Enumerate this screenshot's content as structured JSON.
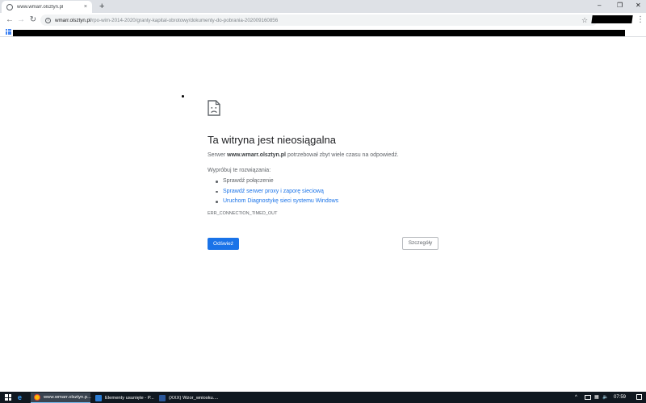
{
  "browser": {
    "tab": {
      "title": "www.wmarr.olsztyn.pl",
      "close_icon": "×"
    },
    "new_tab_icon": "+",
    "window_controls": {
      "minimize": "–",
      "maximize": "❐",
      "close": "✕"
    },
    "nav": {
      "back": "←",
      "forward": "→",
      "reload": "↻"
    },
    "address": {
      "host": "wmarr.olsztyn.pl",
      "path": "/rpo-wim-2014-2020/granty-kapital-obrotowy/dokumenty-do-pobrania-202009160856"
    },
    "star_icon": "☆",
    "menu_icon": "⋮"
  },
  "error_page": {
    "title": "Ta witryna jest nieosiągalna",
    "desc_prefix": "Serwer ",
    "desc_host": "www.wmarr.olsztyn.pl",
    "desc_suffix": " potrzebował zbyt wiele czasu na odpowiedź.",
    "try_label": "Wypróbuj te rozwiązania:",
    "suggestions": [
      "Sprawdź połączenie",
      "Sprawdź serwer proxy i zaporę sieciową",
      "Uruchom Diagnostykę sieci systemu Windows"
    ],
    "error_code": "ERR_CONNECTION_TIMED_OUT",
    "reload_label": "Odśwież",
    "details_label": "Szczegóły"
  },
  "taskbar": {
    "tasks": [
      {
        "label": "www.wmarr.olsztyn.p...",
        "icon_color": "#fbbc05"
      },
      {
        "label": "Elementy usunięte - P...",
        "icon_color": "#2b7cd3"
      },
      {
        "label": "(XXX) Wzor_wniosku....",
        "icon_color": "#2b579a"
      }
    ],
    "tray": {
      "chevron": "^",
      "volume": "🔈",
      "time": "07:59"
    }
  },
  "colors": {
    "accent": "#1a73e8",
    "taskbar": "#101820",
    "tabstrip": "#dee1e6"
  }
}
